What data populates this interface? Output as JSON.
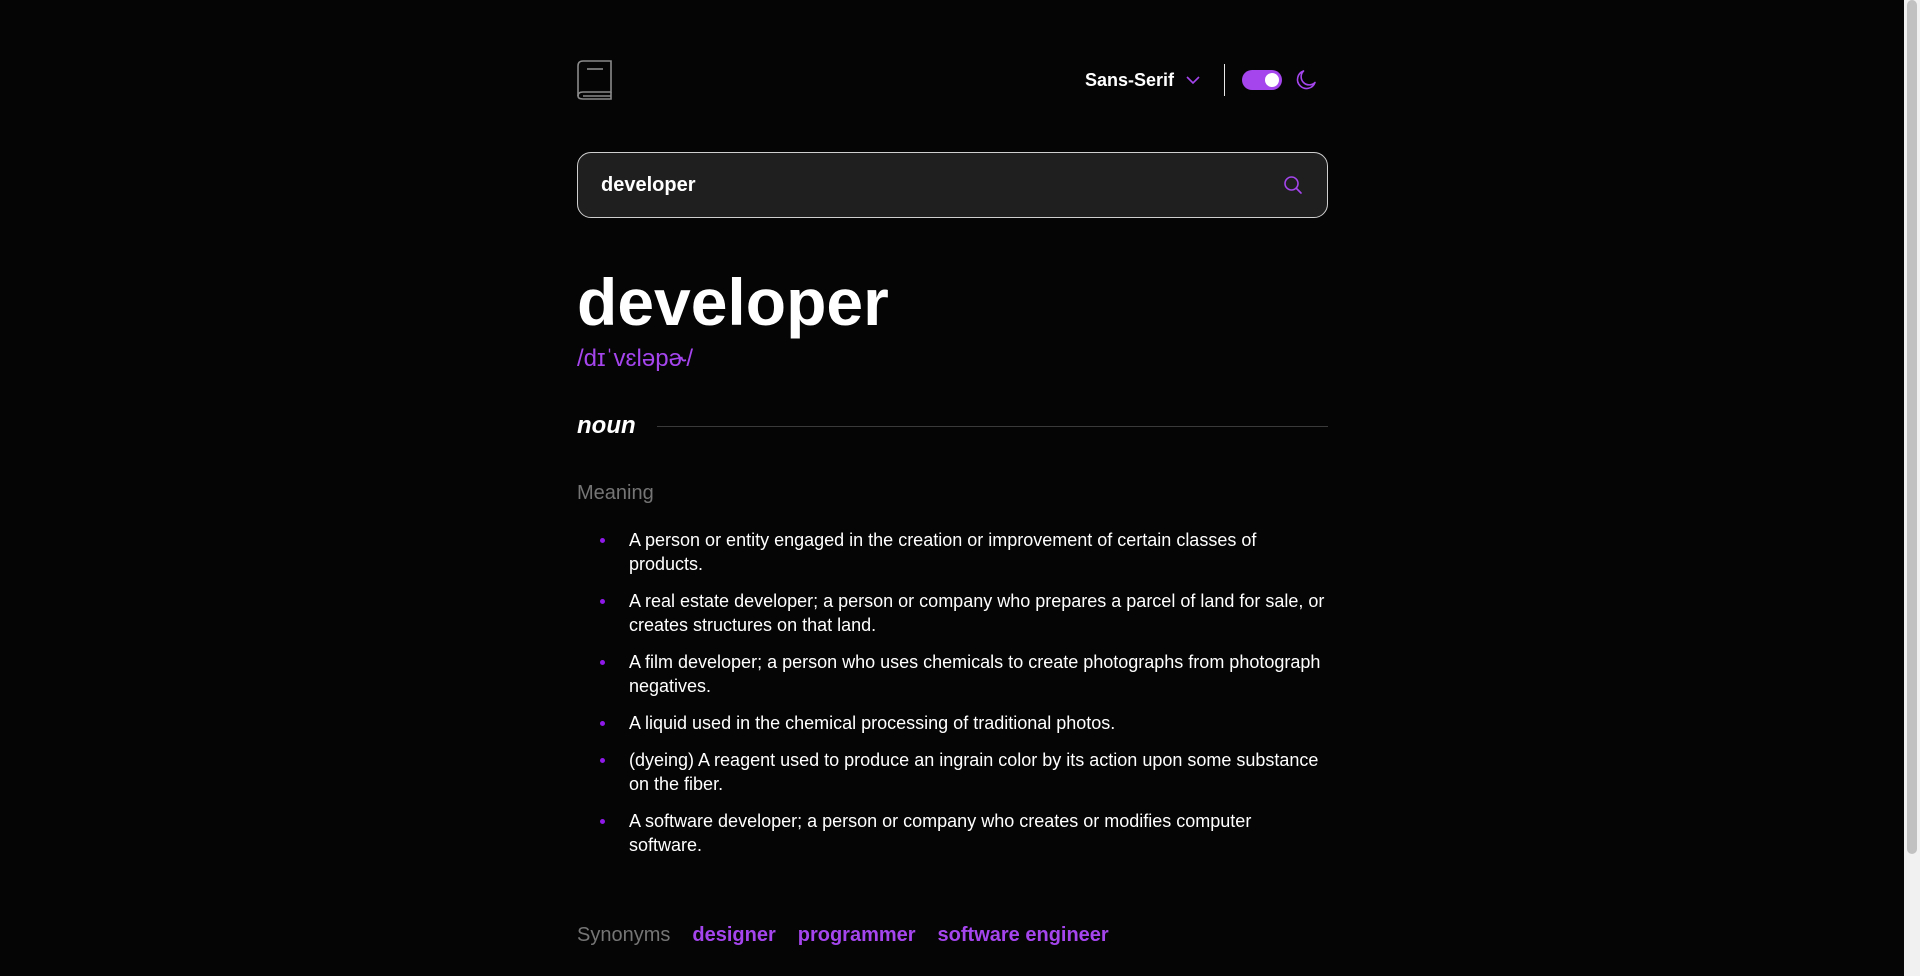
{
  "header": {
    "font_label": "Sans-Serif",
    "theme_toggle_on": true,
    "accent_color": "#a445ed"
  },
  "search": {
    "value": "developer"
  },
  "entry": {
    "word": "developer",
    "phonetic": "/dɪˈvɛləpɚ/",
    "part_of_speech": "noun",
    "meaning_heading": "Meaning",
    "definitions": [
      "A person or entity engaged in the creation or improvement of certain classes of products.",
      "A real estate developer; a person or company who prepares a parcel of land for sale, or creates structures on that land.",
      "A film developer; a person who uses chemicals to create photographs from photograph negatives.",
      "A liquid used in the chemical processing of traditional photos.",
      "(dyeing) A reagent used to produce an ingrain color by its action upon some substance on the fiber.",
      "A software developer; a person or company who creates or modifies computer software."
    ],
    "synonyms_heading": "Synonyms",
    "synonyms": [
      "designer",
      "programmer",
      "software engineer"
    ]
  }
}
